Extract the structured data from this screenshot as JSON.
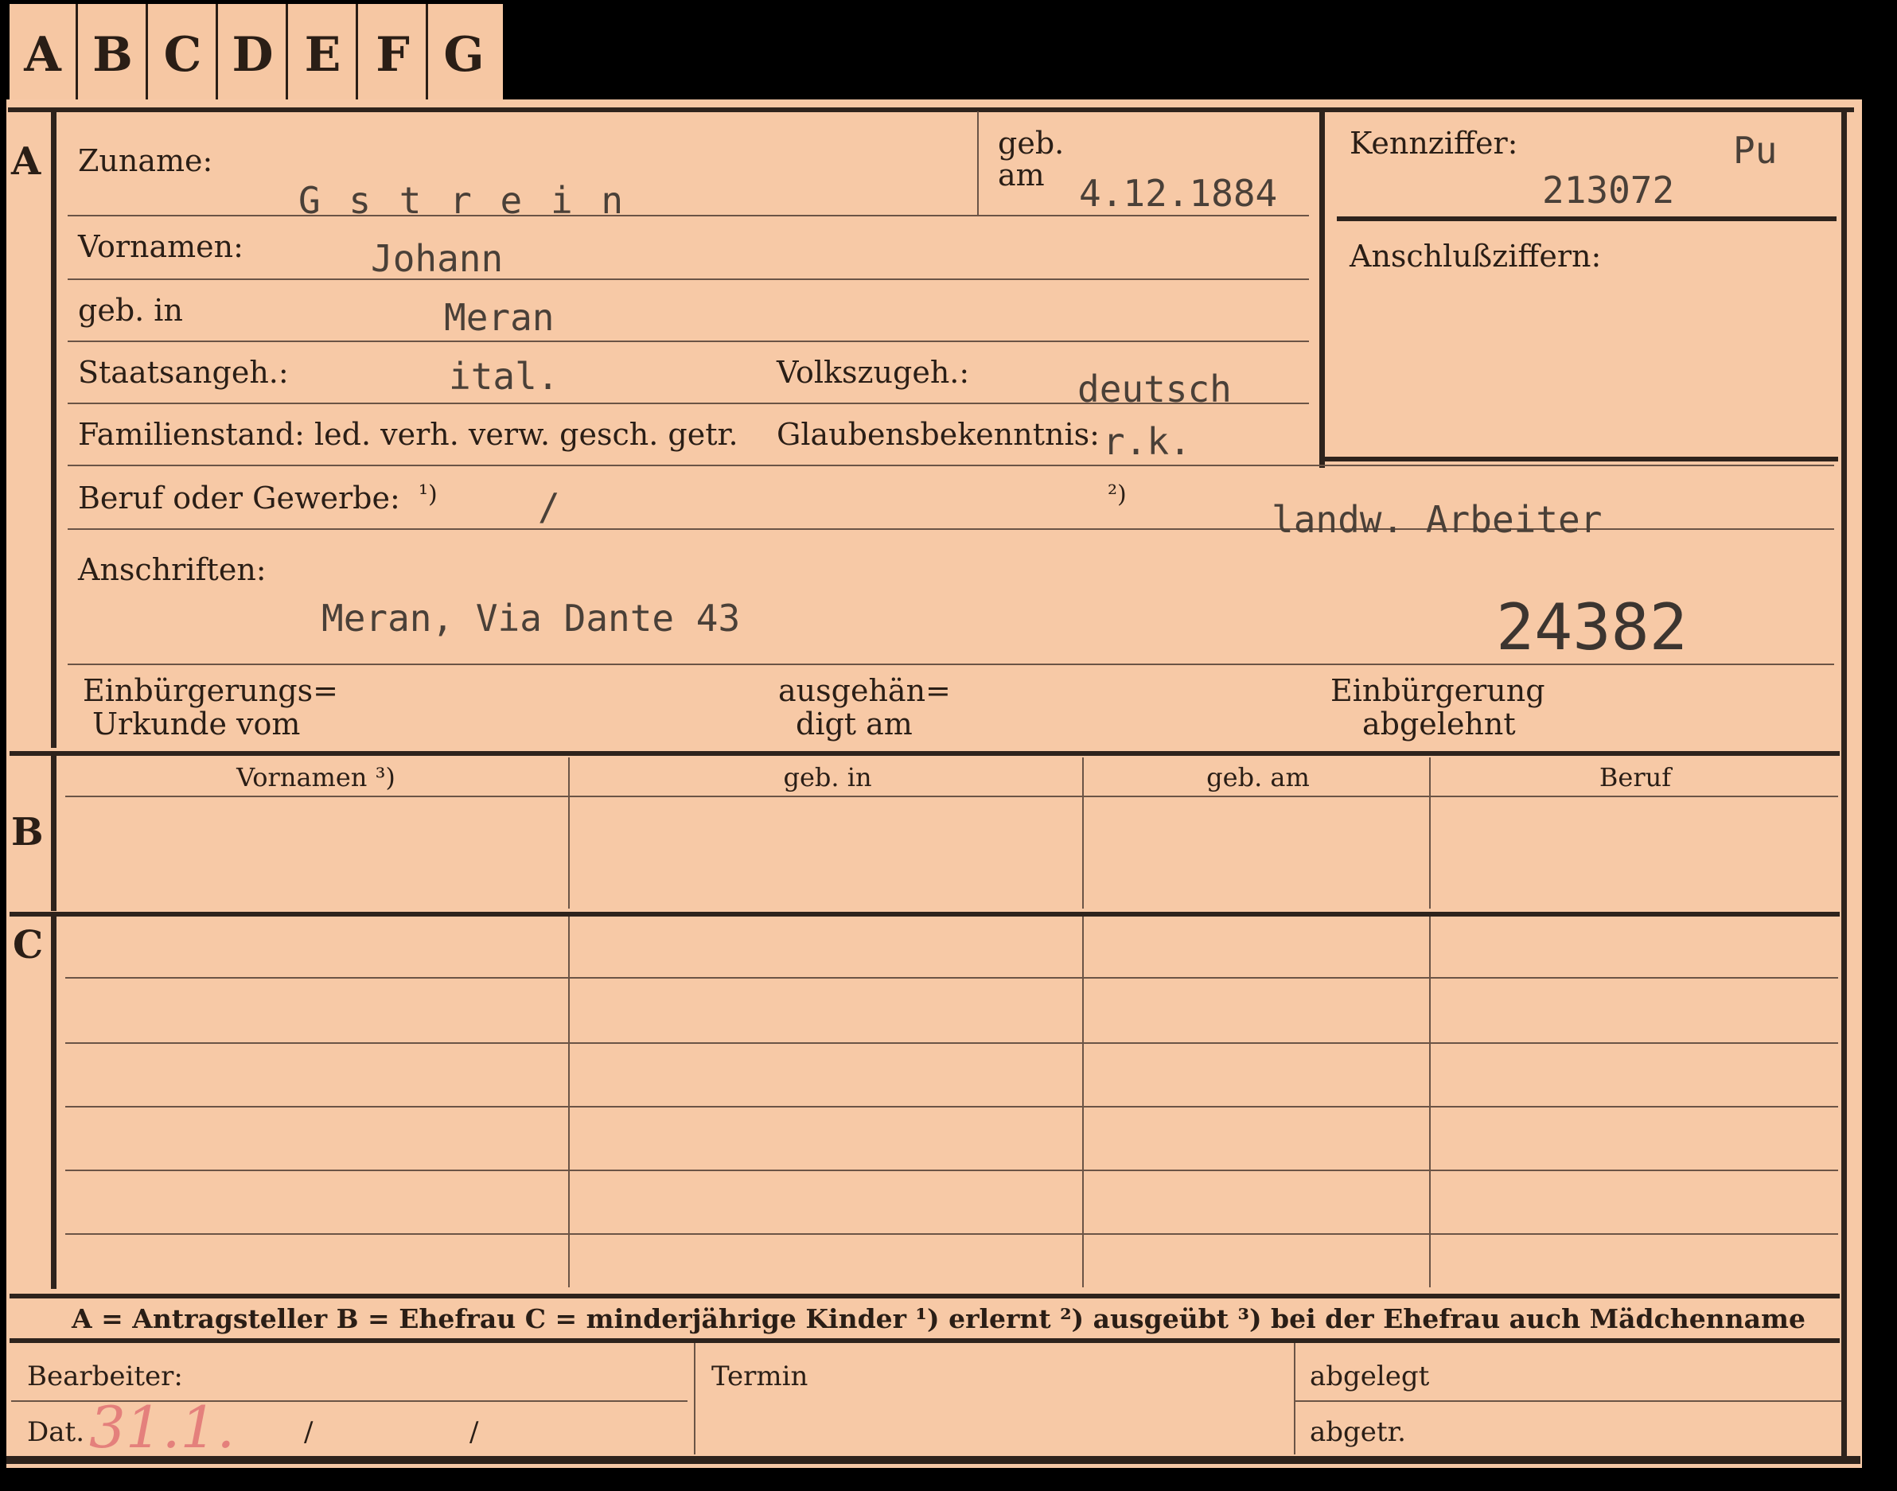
{
  "tabs": [
    "A",
    "B",
    "C",
    "D",
    "E",
    "F",
    "G"
  ],
  "row_markers": {
    "a": "A",
    "b": "B",
    "c": "C"
  },
  "labels": {
    "zuname": "Zuname:",
    "geb_am": "geb.",
    "geb_am2": "am",
    "vornamen": "Vornamen:",
    "geb_in": "geb. in",
    "staatsangeh": "Staatsangeh.:",
    "volkszugeh": "Volkszugeh.:",
    "familienstand": "Familienstand: led. verh. verw. gesch. getr.",
    "glaubensbekenntnis": "Glaubensbekenntnis:",
    "beruf": "Beruf oder Gewerbe:",
    "beruf_fn1": "¹)",
    "beruf_fn2": "²)",
    "anschriften": "Anschriften:",
    "einbuergerungs1": "Einbürgerungs=",
    "einbuergerungs2": "Urkunde vom",
    "ausgehaen1": "ausgehän=",
    "ausgehaen2": "digt am",
    "abgelehnt1": "Einbürgerung",
    "abgelehnt2": "abgelehnt",
    "kennziffer": "Kennziffer:",
    "anschlussziffern": "Anschlußziffern:"
  },
  "values": {
    "zuname": "G s t r e i n",
    "geb_am": "4.12.1884",
    "vornamen": "Johann",
    "geb_in": "Meran",
    "staatsangeh": "ital.",
    "volkszugeh": "deutsch",
    "glaubensbekenntnis": "r.k.",
    "beruf1": "/",
    "beruf2": "landw. Arbeiter",
    "anschrift": "Meran, Via Dante 43",
    "stamp_number": "24382",
    "kennziffer_code": "Pu",
    "kennziffer_number": "213072"
  },
  "table_headers": [
    "Vornamen ³)",
    "geb. in",
    "geb. am",
    "Beruf"
  ],
  "legend": "A = Antragsteller   B = Ehefrau   C = minderjährige Kinder   ¹) erlernt   ²) ausgeübt   ³) bei der Ehefrau auch Mädchenname",
  "footer": {
    "bearbeiter": "Bearbeiter:",
    "dat": "Dat.",
    "dat_handwritten": "31.1.",
    "slash1": "/",
    "slash2": "/",
    "termin": "Termin",
    "abgelegt": "abgelegt",
    "abgetr": "abgetr."
  }
}
